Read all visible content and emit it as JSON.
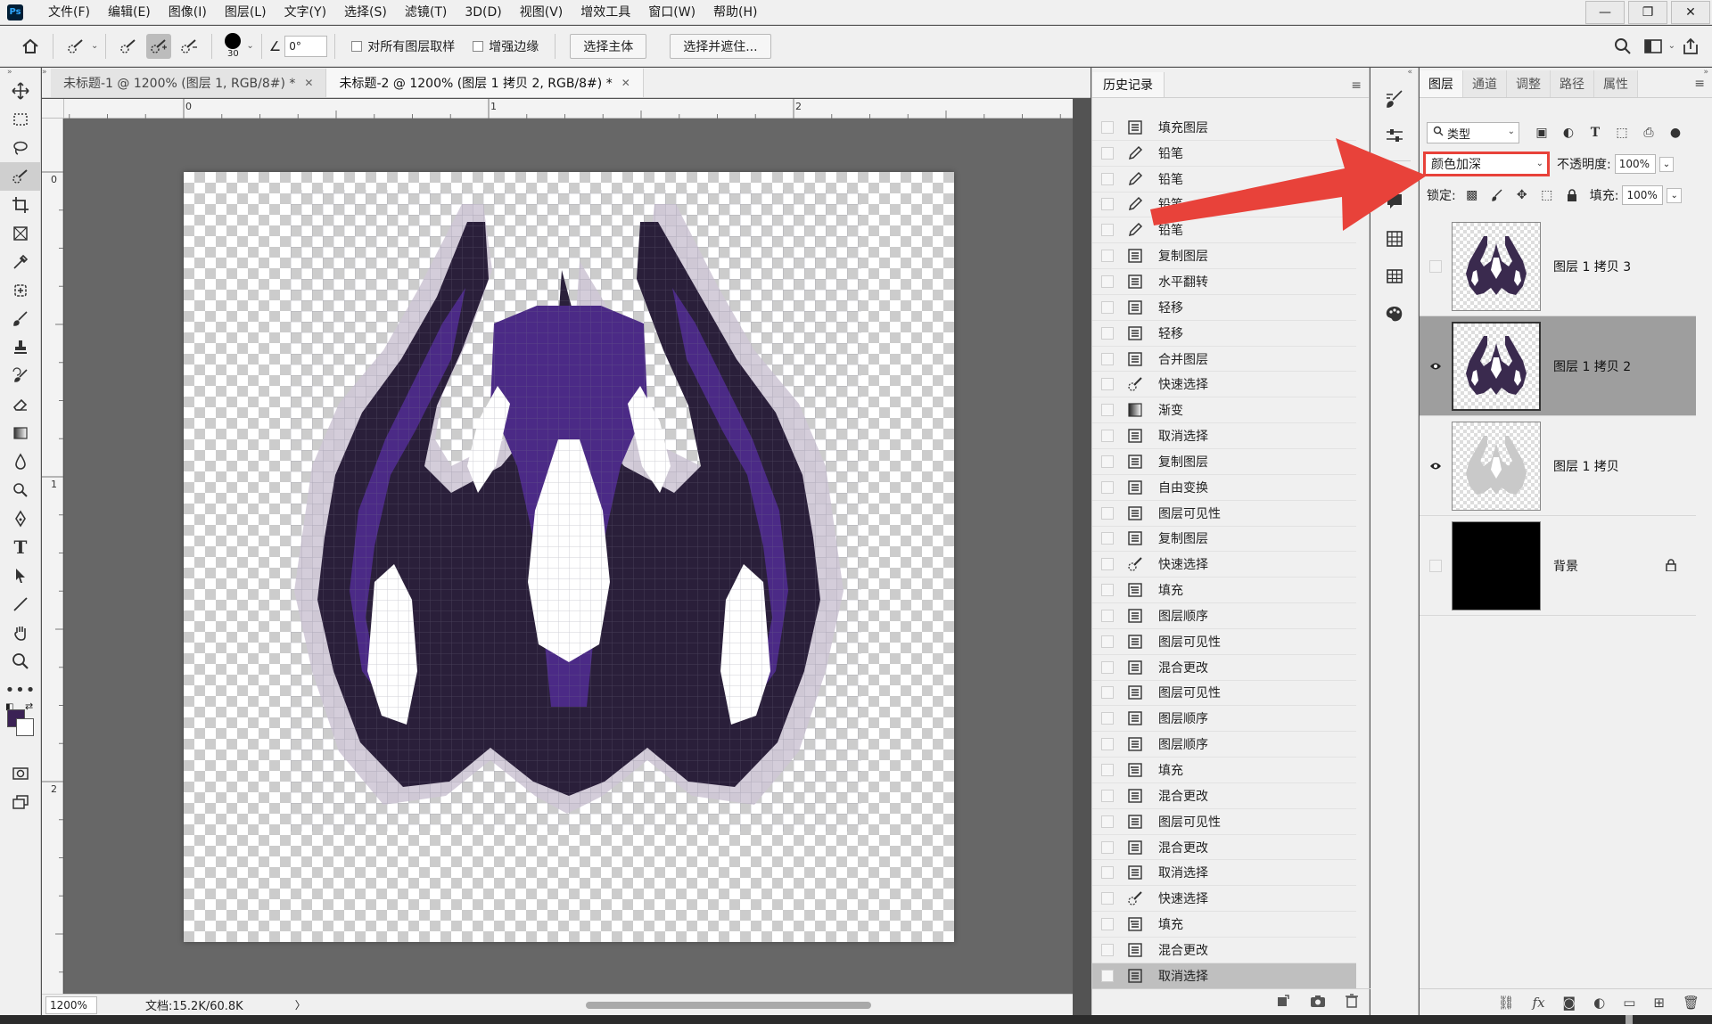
{
  "app": {
    "logo_text": "Ps"
  },
  "menu": [
    "文件(F)",
    "编辑(E)",
    "图像(I)",
    "图层(L)",
    "文字(Y)",
    "选择(S)",
    "滤镜(T)",
    "3D(D)",
    "视图(V)",
    "增效工具",
    "窗口(W)",
    "帮助(H)"
  ],
  "window_controls": {
    "minimize": "—",
    "restore": "❐",
    "close": "✕"
  },
  "options": {
    "brush_size": "30",
    "angle_value": "0°",
    "sample_all_layers": "对所有图层取样",
    "enhance_edge": "增强边缘",
    "select_subject": "选择主体",
    "select_and_mask": "选择并遮住..."
  },
  "colors": {
    "foreground": "#3b2255",
    "accent_red": "#e8423a"
  },
  "doc_tabs": [
    {
      "label": "未标题-1 @ 1200% (图层 1, RGB/8#) *",
      "active": false
    },
    {
      "label": "未标题-2 @ 1200% (图层 1 拷贝 2, RGB/8#) *",
      "active": true
    }
  ],
  "ruler": {
    "h_labels": [
      "0",
      "1",
      "2"
    ],
    "v_labels": [
      "0",
      "1",
      "2"
    ]
  },
  "status": {
    "zoom": "1200%",
    "doc_info": "文档:15.2K/60.8K",
    "arrow": "〉"
  },
  "history": {
    "tab": "历史记录",
    "items": [
      {
        "label": "填充图层",
        "icon": "doc"
      },
      {
        "label": "铅笔",
        "icon": "pencil"
      },
      {
        "label": "铅笔",
        "icon": "pencil"
      },
      {
        "label": "铅笔",
        "icon": "pencil"
      },
      {
        "label": "铅笔",
        "icon": "pencil"
      },
      {
        "label": "复制图层",
        "icon": "doc"
      },
      {
        "label": "水平翻转",
        "icon": "doc"
      },
      {
        "label": "轻移",
        "icon": "doc"
      },
      {
        "label": "轻移",
        "icon": "doc"
      },
      {
        "label": "合并图层",
        "icon": "doc"
      },
      {
        "label": "快速选择",
        "icon": "quick"
      },
      {
        "label": "渐变",
        "icon": "gradient"
      },
      {
        "label": "取消选择",
        "icon": "doc"
      },
      {
        "label": "复制图层",
        "icon": "doc"
      },
      {
        "label": "自由变换",
        "icon": "doc"
      },
      {
        "label": "图层可见性",
        "icon": "doc"
      },
      {
        "label": "复制图层",
        "icon": "doc"
      },
      {
        "label": "快速选择",
        "icon": "quick"
      },
      {
        "label": "填充",
        "icon": "fill"
      },
      {
        "label": "图层顺序",
        "icon": "doc"
      },
      {
        "label": "图层可见性",
        "icon": "doc"
      },
      {
        "label": "混合更改",
        "icon": "doc"
      },
      {
        "label": "图层可见性",
        "icon": "doc"
      },
      {
        "label": "图层顺序",
        "icon": "doc"
      },
      {
        "label": "图层顺序",
        "icon": "doc"
      },
      {
        "label": "填充",
        "icon": "fill"
      },
      {
        "label": "混合更改",
        "icon": "doc"
      },
      {
        "label": "图层可见性",
        "icon": "doc"
      },
      {
        "label": "混合更改",
        "icon": "doc"
      },
      {
        "label": "取消选择",
        "icon": "doc"
      },
      {
        "label": "快速选择",
        "icon": "quick"
      },
      {
        "label": "填充",
        "icon": "fill"
      },
      {
        "label": "混合更改",
        "icon": "doc"
      },
      {
        "label": "取消选择",
        "icon": "doc",
        "selected": true
      }
    ]
  },
  "layers_panel": {
    "tabs": [
      "图层",
      "通道",
      "调整",
      "路径",
      "属性"
    ],
    "filter_label": "类型",
    "blend_mode": "颜色加深",
    "opacity_label": "不透明度:",
    "opacity_value": "100%",
    "lock_label": "锁定:",
    "fill_label": "填充:",
    "fill_value": "100%",
    "layers": [
      {
        "name": "图层 1 拷贝 3",
        "visible": false,
        "selected": false,
        "thumb": "dark"
      },
      {
        "name": "图层 1 拷贝 2",
        "visible": true,
        "selected": true,
        "thumb": "dark"
      },
      {
        "name": "图层 1 拷贝",
        "visible": true,
        "selected": false,
        "thumb": "light"
      },
      {
        "name": "背景",
        "visible": false,
        "selected": false,
        "thumb": "black",
        "locked": true
      }
    ]
  }
}
